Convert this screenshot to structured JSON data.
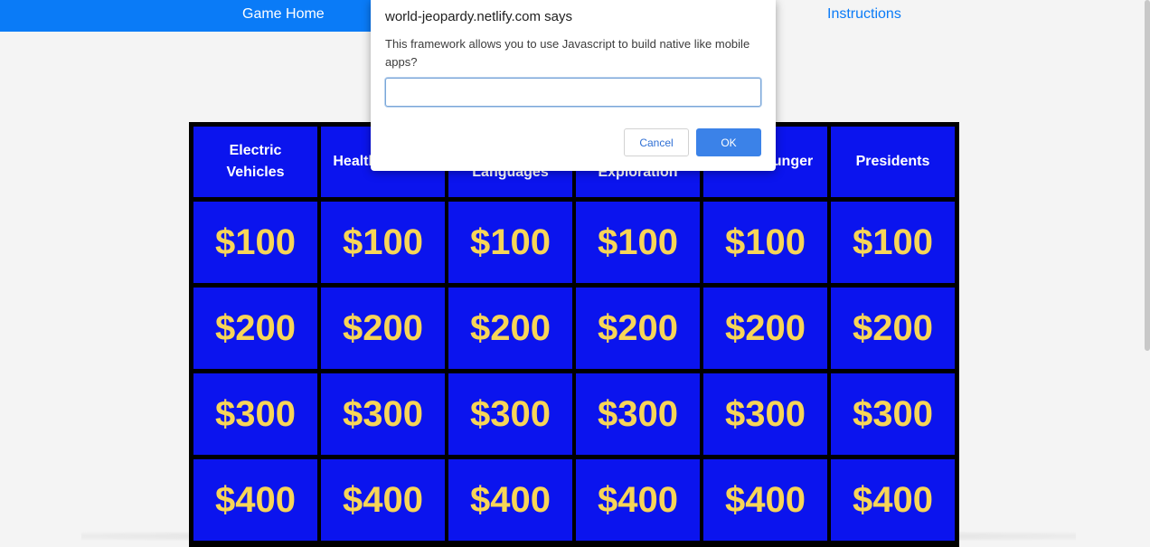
{
  "nav": {
    "home_label": "Game Home",
    "instructions_label": "Instructions"
  },
  "board": {
    "categories": [
      {
        "label": "Electric Vehicles"
      },
      {
        "label": "Healthy Foods"
      },
      {
        "label": "World Languages"
      },
      {
        "label": "Space Exploration"
      },
      {
        "label": "World Hunger"
      },
      {
        "label": "Presidents"
      }
    ],
    "values": [
      "$100",
      "$200",
      "$300",
      "$400"
    ]
  },
  "dialog": {
    "title": "world-jeopardy.netlify.com says",
    "message": "This framework allows you to use Javascript to build native like mobile apps?",
    "input_value": "",
    "cancel_label": "Cancel",
    "ok_label": "OK"
  },
  "colors": {
    "nav_blue": "#0a7bf7",
    "board_cell": "#0b14ee",
    "value_gold": "#f7d558",
    "ok_button": "#3b82e8"
  }
}
